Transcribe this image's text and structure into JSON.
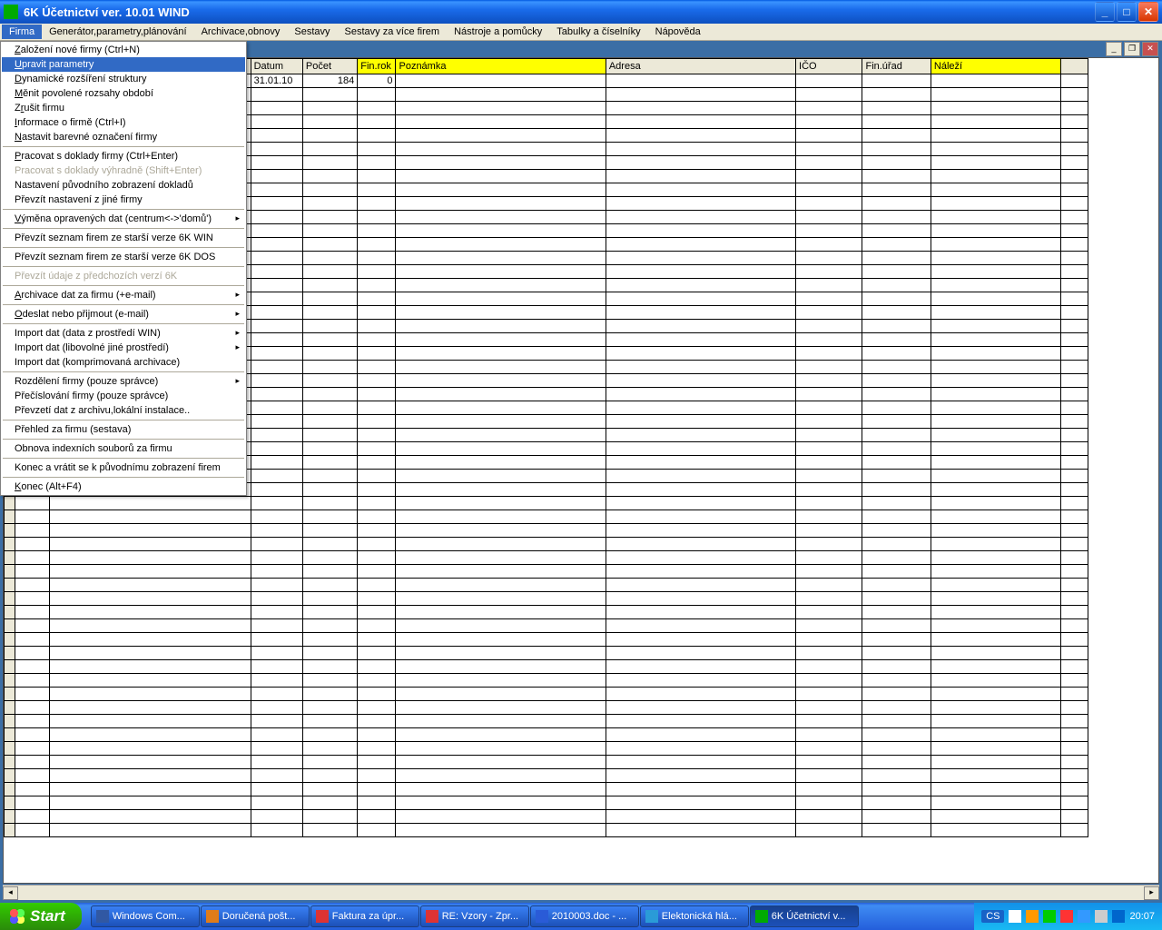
{
  "window": {
    "title": "6K Účetnictví ver. 10.01 WIND"
  },
  "menubar": [
    "Firma",
    "Generátor,parametry,plánování",
    "Archivace,obnovy",
    "Sestavy",
    "Sestavy za více firem",
    "Nástroje a pomůcky",
    "Tabulky a číselníky",
    "Nápověda"
  ],
  "dropdown": {
    "groups": [
      [
        {
          "label": "Založení nové firmy (Ctrl+N)",
          "ul": "Z"
        },
        {
          "label": "Upravit    parametry",
          "ul": "U",
          "hl": true
        },
        {
          "label": "Dynamické rozšíření struktury",
          "ul": "D"
        },
        {
          "label": "Měnit povolené rozsahy období",
          "ul": "M"
        },
        {
          "label": "Zrušit    firmu",
          "ul": "r"
        },
        {
          "label": "Informace o firmě  (Ctrl+I)",
          "ul": "I"
        },
        {
          "label": "Nastavit barevné označení firmy",
          "ul": "N"
        }
      ],
      [
        {
          "label": "Pracovat s doklady firmy  (Ctrl+Enter)",
          "ul": "P"
        },
        {
          "label": "Pracovat s doklady výhradně  (Shift+Enter)",
          "disabled": true
        },
        {
          "label": "Nastavení původního zobrazení dokladů"
        },
        {
          "label": "Převzít nastavení z jiné firmy"
        }
      ],
      [
        {
          "label": "Výměna opravených dat (centrum<->'domů')",
          "ul": "V",
          "arrow": true
        }
      ],
      [
        {
          "label": "Převzít seznam firem ze starší verze 6K WIN"
        }
      ],
      [
        {
          "label": "Převzít seznam firem ze starší verze 6K DOS"
        }
      ],
      [
        {
          "label": "Převzít  údaje z předchozích verzí 6K",
          "disabled": true
        }
      ],
      [
        {
          "label": "Archivace dat za firmu (+e-mail)",
          "ul": "A",
          "arrow": true
        }
      ],
      [
        {
          "label": "Odeslat nebo přijmout (e-mail)",
          "ul": "O",
          "arrow": true
        }
      ],
      [
        {
          "label": "Import dat (data z prostředí WIN)",
          "arrow": true
        },
        {
          "label": "Import dat (libovolné jiné prostředí)",
          "arrow": true
        },
        {
          "label": "Import dat  (komprimovaná archivace)"
        }
      ],
      [
        {
          "label": "Rozdělení firmy (pouze správce)",
          "arrow": true
        },
        {
          "label": "Přečíslování firmy (pouze správce)"
        },
        {
          "label": "Převzetí dat z archivu,lokální instalace.."
        }
      ],
      [
        {
          "label": "Přehled za firmu (sestava)"
        }
      ],
      [
        {
          "label": "Obnova indexních souborů za firmu"
        }
      ],
      [
        {
          "label": "Konec a vrátit se k původnímu zobrazení firem"
        }
      ],
      [
        {
          "label": "Konec  (Alt+F4)",
          "ul": "K"
        }
      ]
    ]
  },
  "grid": {
    "headers": [
      {
        "label": "",
        "cls": "selector-col"
      },
      {
        "label": "",
        "cls": "col-num"
      },
      {
        "label": "",
        "cls": "col-nazev"
      },
      {
        "label": "Datum",
        "cls": "col-datum"
      },
      {
        "label": "Počet",
        "cls": "col-pocet"
      },
      {
        "label": "Fin.rok",
        "cls": "col-finrok",
        "yellow": true
      },
      {
        "label": "Poznámka",
        "cls": "col-pozn",
        "yellow": true
      },
      {
        "label": "Adresa",
        "cls": "col-adresa"
      },
      {
        "label": "IČO",
        "cls": "col-ico"
      },
      {
        "label": "Fin.úřad",
        "cls": "col-finurad"
      },
      {
        "label": "Náleží",
        "cls": "col-nalezi",
        "yellow": true
      },
      {
        "label": "",
        "cls": "col-end"
      }
    ],
    "row0": {
      "datum": "31.01.10",
      "pocet": "184",
      "finrok": "0"
    },
    "empty_rows": 55
  },
  "taskbar": {
    "start": "Start",
    "items": [
      {
        "label": "Windows Com...",
        "color": "#3158a3"
      },
      {
        "label": "Doručená pošt...",
        "color": "#e07c1a"
      },
      {
        "label": "Faktura za úpr...",
        "color": "#d33"
      },
      {
        "label": "RE: Vzory - Zpr...",
        "color": "#d33"
      },
      {
        "label": "2010003.doc - ...",
        "color": "#2a5bd7"
      },
      {
        "label": "Elektonická hlá...",
        "color": "#2a9bd7"
      },
      {
        "label": "6K Účetnictví v...",
        "color": "#0a0",
        "active": true
      }
    ],
    "lang": "CS",
    "time": "20:07"
  }
}
